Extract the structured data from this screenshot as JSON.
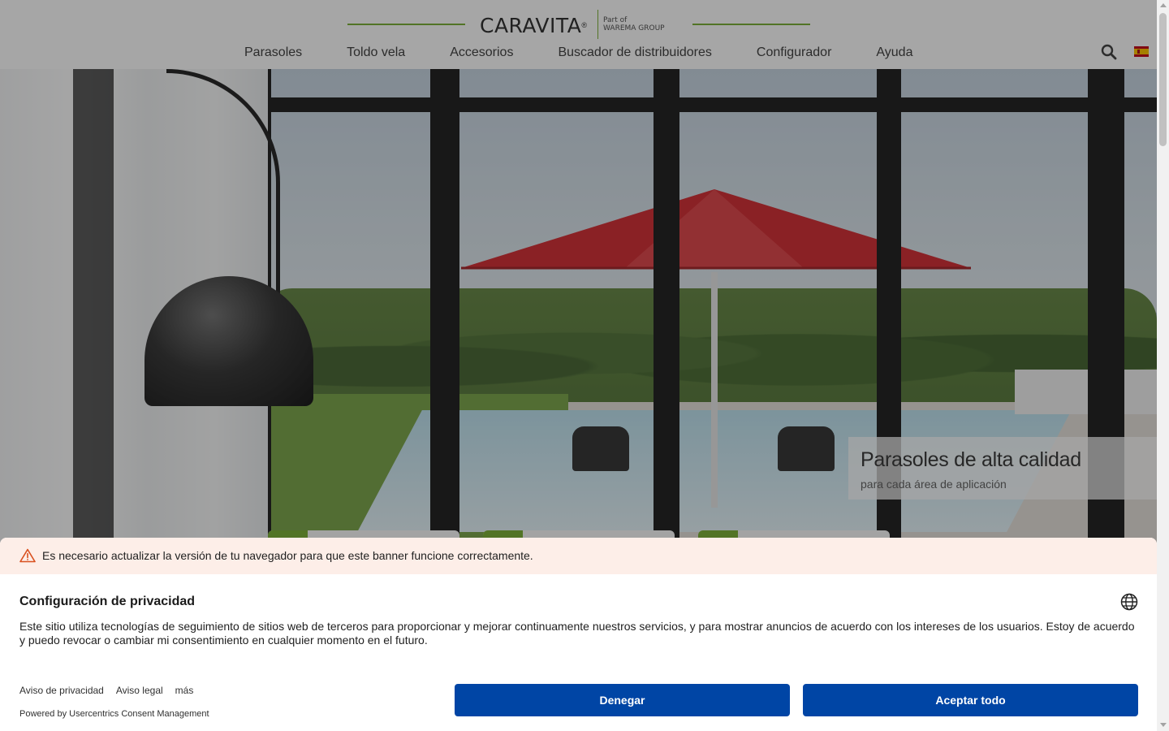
{
  "header": {
    "logo_text": "CARAVITA",
    "logo_reg": "®",
    "logo_sub_line1": "Part of",
    "logo_sub_line2": "WAREMA GROUP",
    "nav": [
      "Parasoles",
      "Toldo vela",
      "Accesorios",
      "Buscador de distribuidores",
      "Configurador",
      "Ayuda"
    ],
    "search_icon": "search-icon",
    "language_icon": "spain-flag-icon"
  },
  "hero": {
    "caption_title": "Parasoles de alta calidad",
    "caption_subtitle": "para cada área de aplicación"
  },
  "consent": {
    "warning": "Es necesario actualizar la versión de tu navegador para que este banner funcione correctamente.",
    "title": "Configuración de privacidad",
    "text": "Este sitio utiliza tecnologías de seguimiento de sitios web de terceros para proporcionar y mejorar continuamente nuestros servicios, y para mostrar anuncios de acuerdo con los intereses de los usuarios. Estoy de acuerdo y puedo revocar o cambiar mi consentimiento en cualquier momento en el futuro.",
    "links": [
      "Aviso de privacidad",
      "Aviso legal",
      "más"
    ],
    "powered_by": "Powered by Usercentrics Consent Management",
    "deny_label": "Denegar",
    "accept_label": "Aceptar todo",
    "button_color": "#0045a5"
  },
  "colors": {
    "brand_green": "#7fb23b",
    "warning_bg": "#fdeee8",
    "umbrella_red": "#d4343a"
  }
}
